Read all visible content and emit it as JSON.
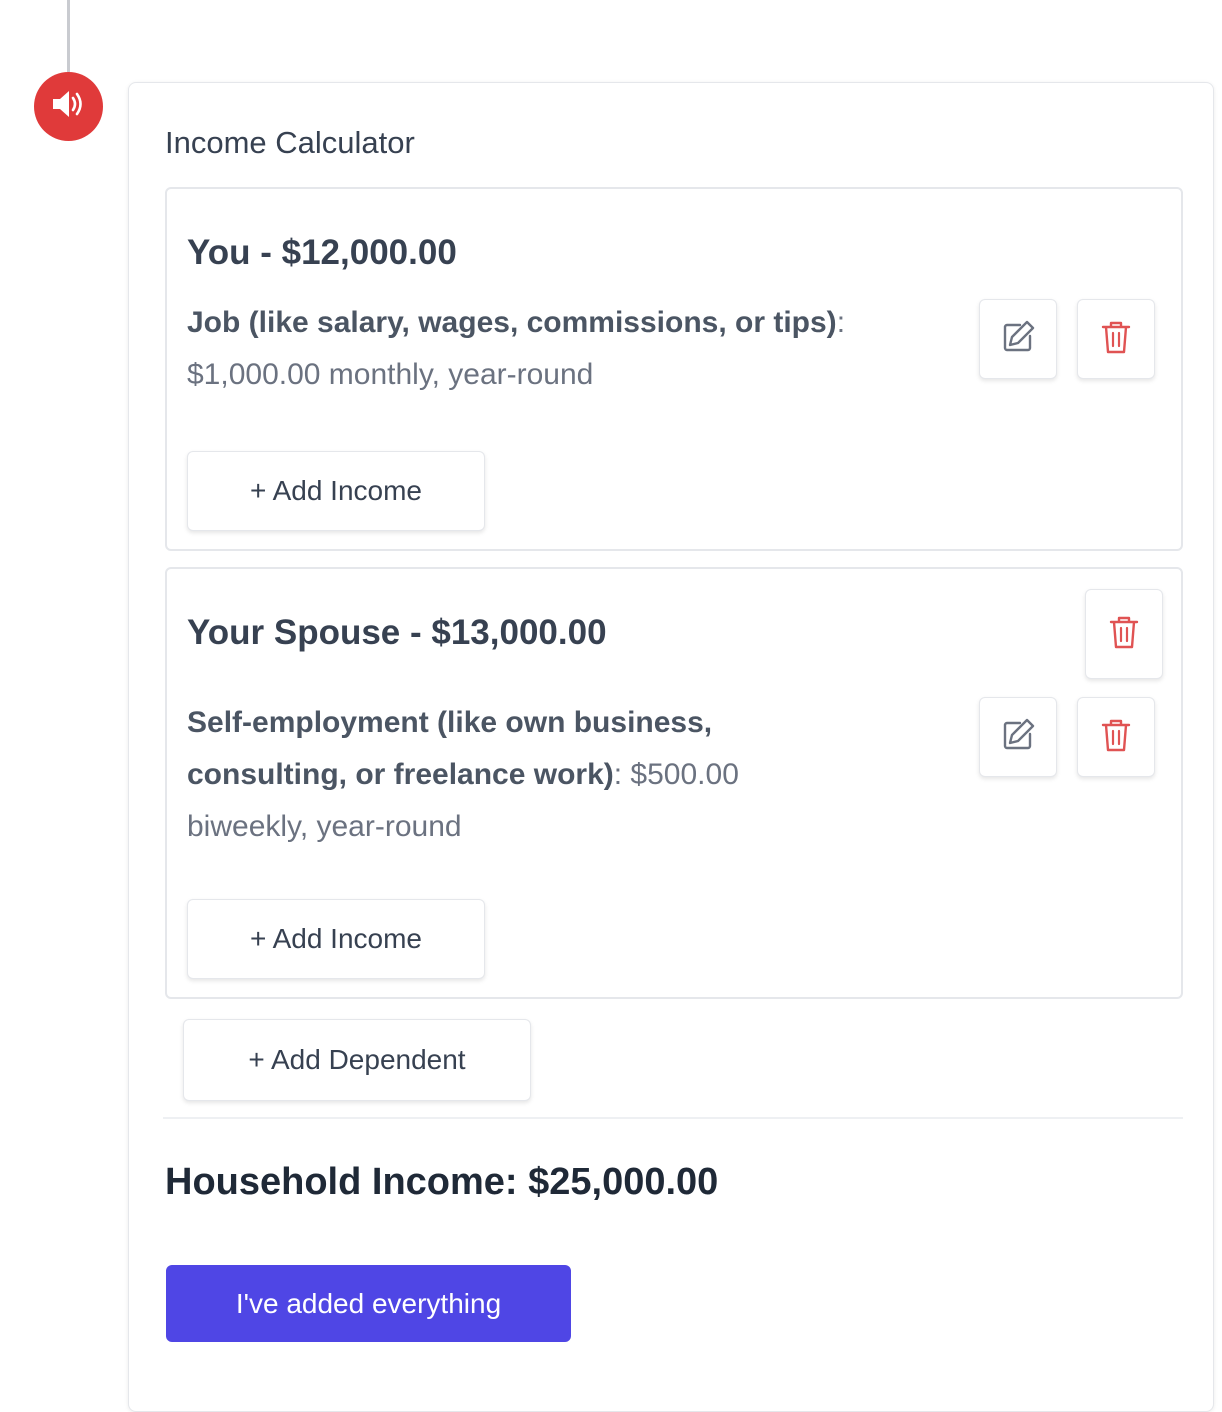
{
  "calculator": {
    "title": "Income Calculator",
    "members": [
      {
        "name": "You - $12,000.00",
        "incomes": [
          {
            "type": "Job (like salary, wages, commissions, or tips)",
            "details": ": $1,000.00 monthly, year-round"
          }
        ],
        "add_income_label": "+ Add Income"
      },
      {
        "name": "Your Spouse - $13,000.00",
        "incomes": [
          {
            "type": "Self-employment (like own business, consulting, or freelance work)",
            "details": ": $500.00 biweekly, year-round"
          }
        ],
        "add_income_label": "+ Add Income"
      }
    ],
    "add_dependent_label": "+ Add Dependent",
    "household_income": "Household Income: $25,000.00",
    "done_label": "I've added everything"
  },
  "icons": {
    "speaker": "speaker-icon",
    "edit": "edit-icon",
    "trash": "trash-icon"
  },
  "colors": {
    "accent": "#4f46e5",
    "danger": "#e03a3a",
    "trash": "#e05353"
  }
}
